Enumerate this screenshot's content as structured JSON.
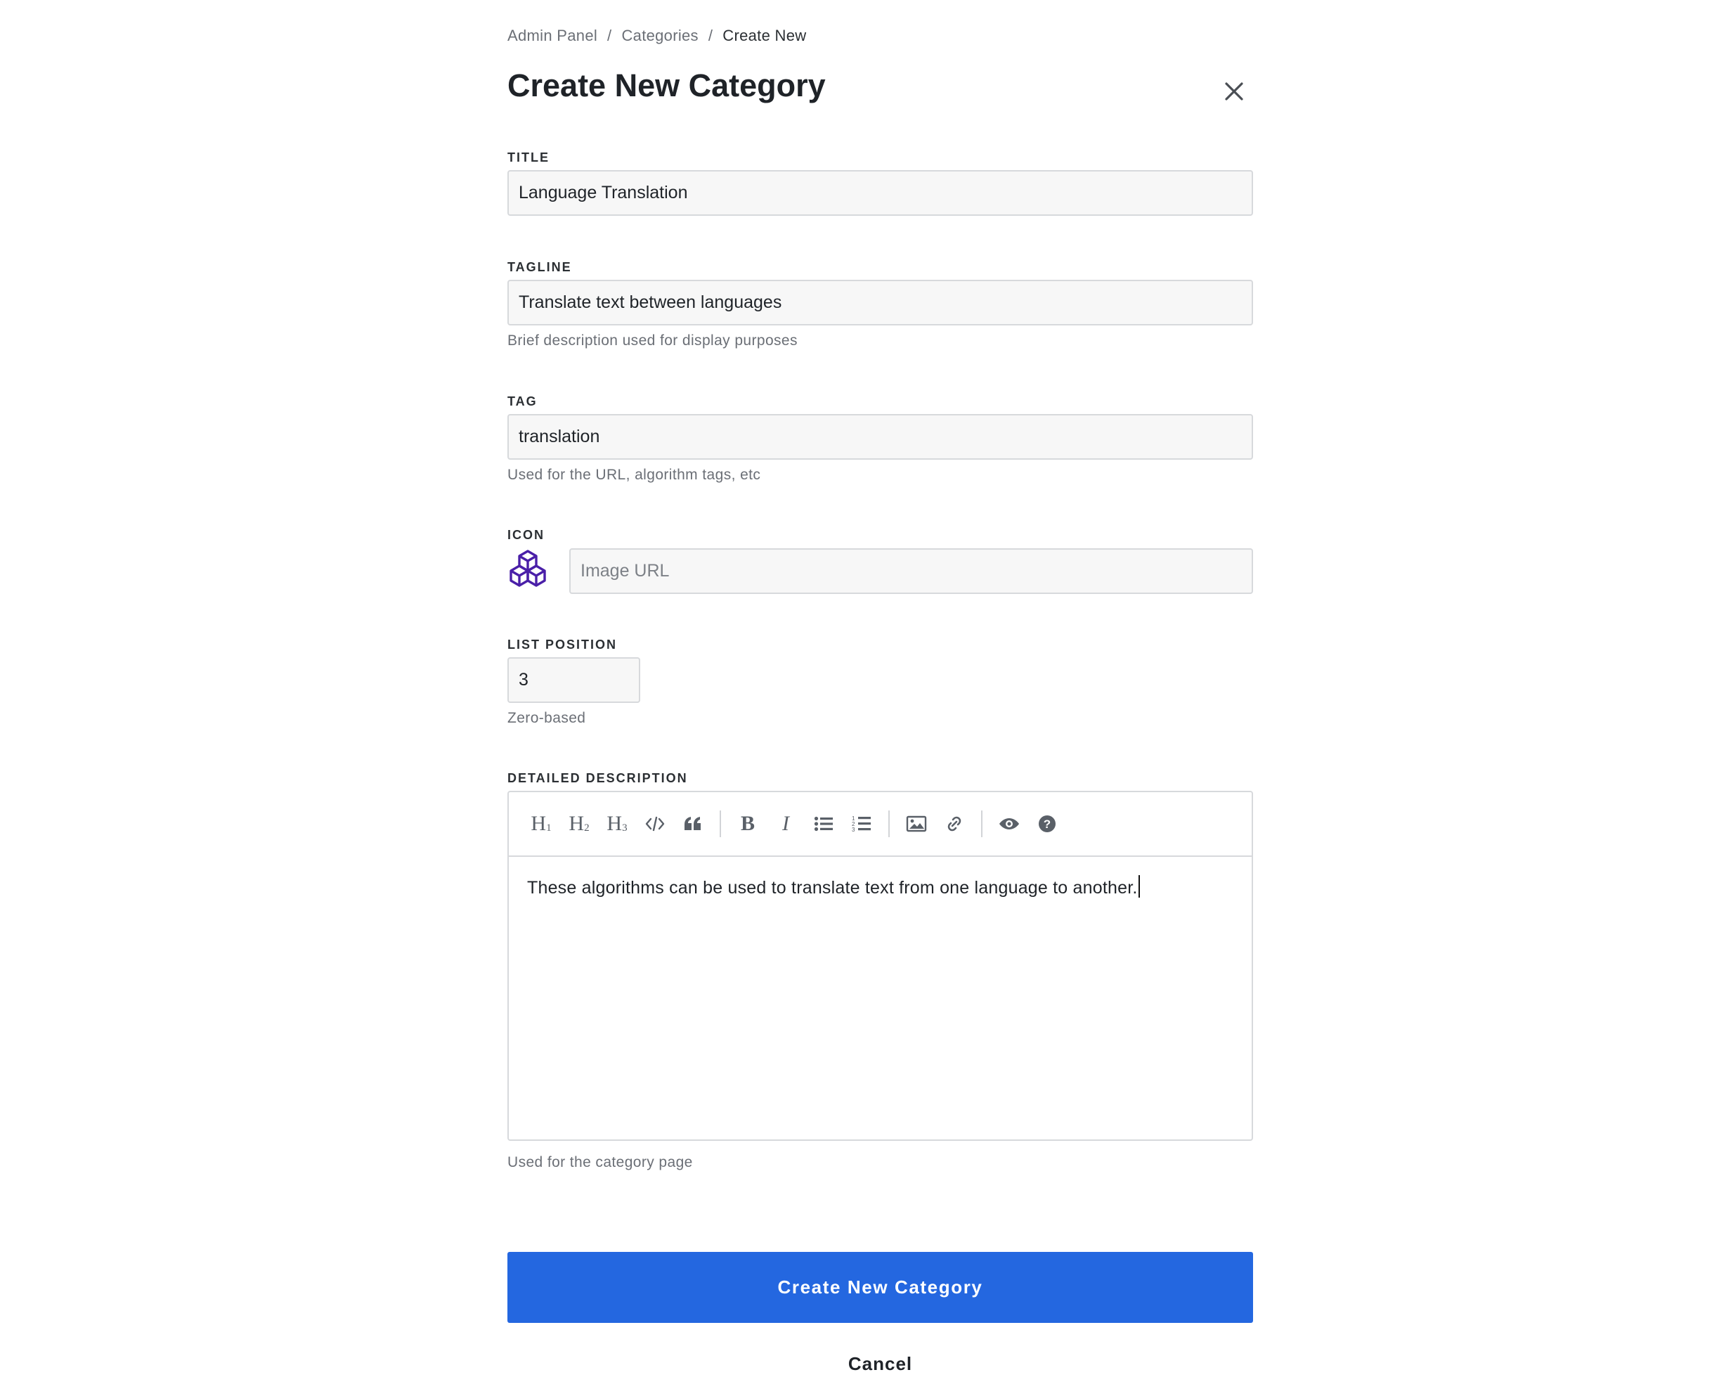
{
  "breadcrumb": {
    "items": [
      "Admin Panel",
      "Categories",
      "Create New"
    ],
    "separator": "/"
  },
  "header": {
    "title": "Create New Category",
    "close_icon": "close-icon"
  },
  "form": {
    "title": {
      "label": "TITLE",
      "value": "Language Translation"
    },
    "tagline": {
      "label": "TAGLINE",
      "value": "Translate text between languages",
      "help": "Brief description used for display purposes"
    },
    "tag": {
      "label": "TAG",
      "value": "translation",
      "help": "Used for the URL, algorithm tags, etc"
    },
    "icon": {
      "label": "ICON",
      "preview_icon": "cubes-icon",
      "preview_color": "#4a1fa8",
      "placeholder": "Image URL",
      "value": ""
    },
    "list_position": {
      "label": "LIST POSITION",
      "value": "3",
      "help": "Zero-based"
    },
    "description": {
      "label": "DETAILED DESCRIPTION",
      "toolbar": [
        {
          "name": "heading-1-icon",
          "text": "H1"
        },
        {
          "name": "heading-2-icon",
          "text": "H2"
        },
        {
          "name": "heading-3-icon",
          "text": "H3"
        },
        {
          "name": "code-icon",
          "text": "</>"
        },
        {
          "name": "quote-icon",
          "text": "❝"
        },
        {
          "name": "bold-icon",
          "text": "B"
        },
        {
          "name": "italic-icon",
          "text": "I"
        },
        {
          "name": "unordered-list-icon"
        },
        {
          "name": "ordered-list-icon"
        },
        {
          "name": "image-icon"
        },
        {
          "name": "link-icon"
        },
        {
          "name": "preview-eye-icon"
        },
        {
          "name": "help-icon",
          "text": "?"
        }
      ],
      "value": "These algorithms can be used to translate text from one language to another.",
      "help": "Used for the category page"
    }
  },
  "actions": {
    "submit_label": "Create New Category",
    "cancel_label": "Cancel"
  },
  "colors": {
    "primary": "#2467e0",
    "icon_accent": "#4a1fa8",
    "field_bg": "#f7f7f7",
    "border": "#d7d9dc"
  }
}
